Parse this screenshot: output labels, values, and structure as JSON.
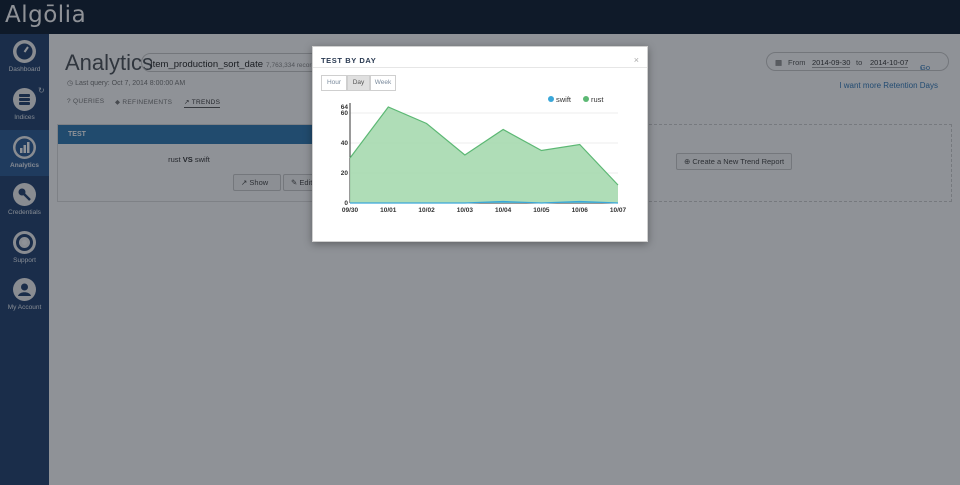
{
  "app": {
    "logo": "Algōlia"
  },
  "sidebar": {
    "items": [
      {
        "label": "Dashboard",
        "icon": "gauge-icon",
        "active": false
      },
      {
        "label": "Indices",
        "icon": "database-icon",
        "active": false
      },
      {
        "label": "Analytics",
        "icon": "bar-chart-icon",
        "active": true
      },
      {
        "label": "Credentials",
        "icon": "key-icon",
        "active": false
      },
      {
        "label": "Support",
        "icon": "lifebuoy-icon",
        "active": false
      },
      {
        "label": "My Account",
        "icon": "user-icon",
        "active": false
      }
    ]
  },
  "header": {
    "title": "Analytics",
    "index_name": "Item_production_sort_date",
    "records": "7,763,334 records",
    "last_query": "Last query: Oct 7, 2014 8:00:00 AM",
    "date_from_label": "From",
    "date_from": "2014-09-30",
    "date_to_label": "to",
    "date_to": "2014-10-07",
    "go_label": "Go",
    "retention_link": "I want more Retention Days"
  },
  "tabs": [
    {
      "label": "QUERIES",
      "active": false
    },
    {
      "label": "REFINEMENTS",
      "active": false
    },
    {
      "label": "TRENDS",
      "active": true
    }
  ],
  "report": {
    "name": "TEST",
    "compare_a": "rust",
    "compare_word": "VS",
    "compare_b": "swift",
    "show_label": "Show",
    "edit_label": "Edit",
    "new_report_label": "Create a New Trend Report"
  },
  "modal": {
    "title": "TEST BY DAY",
    "close": "×",
    "granularity": [
      "Hour",
      "Day",
      "Week"
    ],
    "granularity_selected": "Day"
  },
  "colors": {
    "topbar": "#0b1a2c",
    "sidebar": "#1f3e6b",
    "accent": "#2c78b1",
    "swift": "#3aa7d9",
    "rust": "#5cb874",
    "rust_fill": "#a6d9af"
  },
  "chart_data": {
    "type": "area",
    "x": [
      "09/30",
      "10/01",
      "10/02",
      "10/03",
      "10/04",
      "10/05",
      "10/06",
      "10/07"
    ],
    "series": [
      {
        "name": "swift",
        "values": [
          0,
          0,
          0,
          0,
          1,
          0,
          1,
          0
        ]
      },
      {
        "name": "rust",
        "values": [
          30,
          64,
          53,
          32,
          49,
          35,
          39,
          12
        ]
      }
    ],
    "yticks": [
      0,
      20,
      40,
      60,
      64
    ],
    "ylim": [
      0,
      64
    ],
    "legend": "top-right",
    "grid": true
  }
}
